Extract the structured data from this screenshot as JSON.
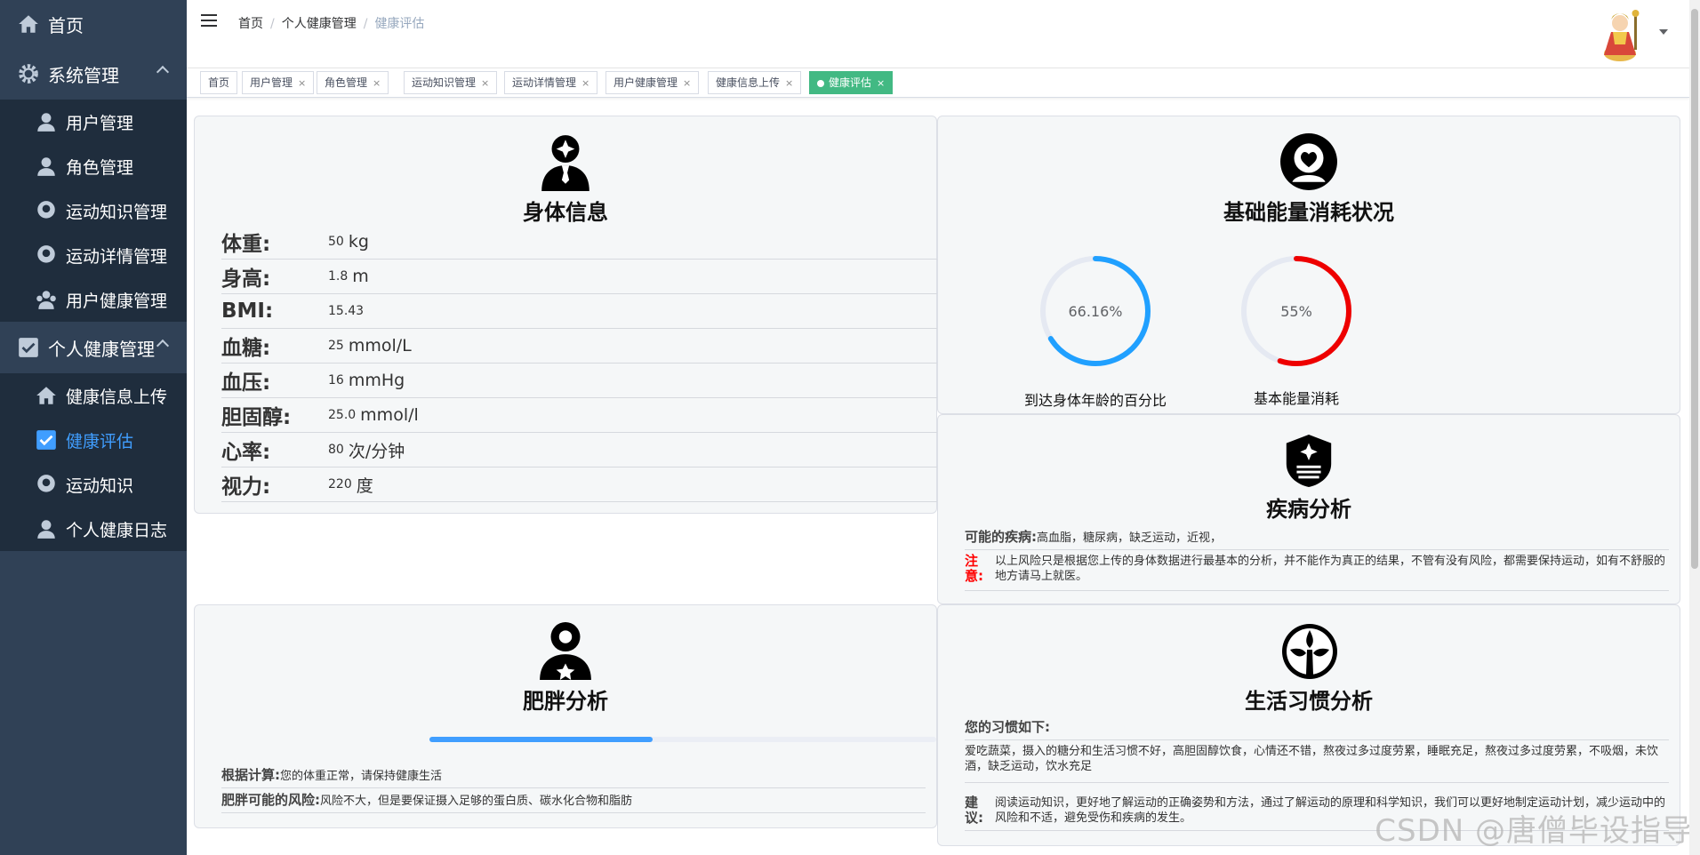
{
  "sidebar": {
    "home": "首页",
    "system": {
      "label": "系统管理",
      "items": [
        "用户管理",
        "角色管理",
        "运动知识管理",
        "运动详情管理",
        "用户健康管理"
      ]
    },
    "personal": {
      "label": "个人健康管理",
      "items": [
        "健康信息上传",
        "健康评估",
        "运动知识",
        "个人健康日志"
      ],
      "active_index": 1
    }
  },
  "breadcrumb": [
    "首页",
    "个人健康管理",
    "健康评估"
  ],
  "tags": [
    {
      "label": "首页",
      "closable": false
    },
    {
      "label": "用户管理",
      "closable": true
    },
    {
      "label": "角色管理",
      "closable": true
    },
    {
      "label": "运动知识管理",
      "closable": true
    },
    {
      "label": "运动详情管理",
      "closable": true
    },
    {
      "label": "用户健康管理",
      "closable": true
    },
    {
      "label": "健康信息上传",
      "closable": true
    },
    {
      "label": "健康评估",
      "closable": true,
      "active": true
    }
  ],
  "tag_close": "×",
  "body_info": {
    "title": "身体信息",
    "rows": [
      {
        "label": "体重:",
        "value": "50",
        "unit": "kg"
      },
      {
        "label": "身高:",
        "value": "1.8",
        "unit": "m"
      },
      {
        "label": "BMI:",
        "value": "15.43",
        "unit": ""
      },
      {
        "label": "血糖:",
        "value": "25",
        "unit": "mmol/L"
      },
      {
        "label": "血压:",
        "value": "16",
        "unit": "mmHg"
      },
      {
        "label": "胆固醇:",
        "value": "25.0",
        "unit": "mmol/l"
      },
      {
        "label": "心率:",
        "value": "80",
        "unit": "次/分钟"
      },
      {
        "label": "视力:",
        "value": "220",
        "unit": "度"
      }
    ]
  },
  "energy": {
    "title": "基础能量消耗状况",
    "circles": [
      {
        "text": "66.16%",
        "percent": 66.16,
        "label": "到达身体年龄的百分比",
        "color": "#20a0ff"
      },
      {
        "text": "55%",
        "percent": 55,
        "label": "基本能量消耗",
        "color": "#ee0000"
      }
    ]
  },
  "disease": {
    "title": "疾病分析",
    "possible_label": "可能的疾病:",
    "possible_value": "高血脂，糖尿病，缺乏运动，近视，",
    "note_label": "注意:",
    "note_text": "以上风险只是根据您上传的身体数据进行最基本的分析，并不能作为真正的结果，不管有没有风险，都需要保持运动，如有不舒服的地方请马上就医。"
  },
  "obesity": {
    "title": "肥胖分析",
    "progress": 0.44,
    "calc_label": "根据计算:",
    "calc_value": "您的体重正常，请保持健康生活",
    "risk_label": "肥胖可能的风险:",
    "risk_value": "风险不大，但是要保证摄入足够的蛋白质、碳水化合物和脂肪"
  },
  "lifestyle": {
    "title": "生活习惯分析",
    "habits_label": "您的习惯如下:",
    "habits_text": "爱吃蔬菜，摄入的糖分和生活习惯不好，高胆固醇饮食，心情还不错，熬夜过多过度劳累，睡眠充足，熬夜过多过度劳累，不吸烟，未饮酒，缺乏运动，饮水充足",
    "advice_label": "建议:",
    "advice_text": "阅读运动知识，更好地了解运动的正确姿势和方法，通过了解运动的原理和科学知识，我们可以更好地制定运动计划，减少运动中的风险和不适，避免受伤和疾病的发生。"
  },
  "watermark": "CSDN @唐僧毕设指导",
  "colors": {
    "sidebar": "#304156",
    "submenu": "#1f2d3d",
    "active": "#409eff",
    "tag_active": "#42b983"
  }
}
